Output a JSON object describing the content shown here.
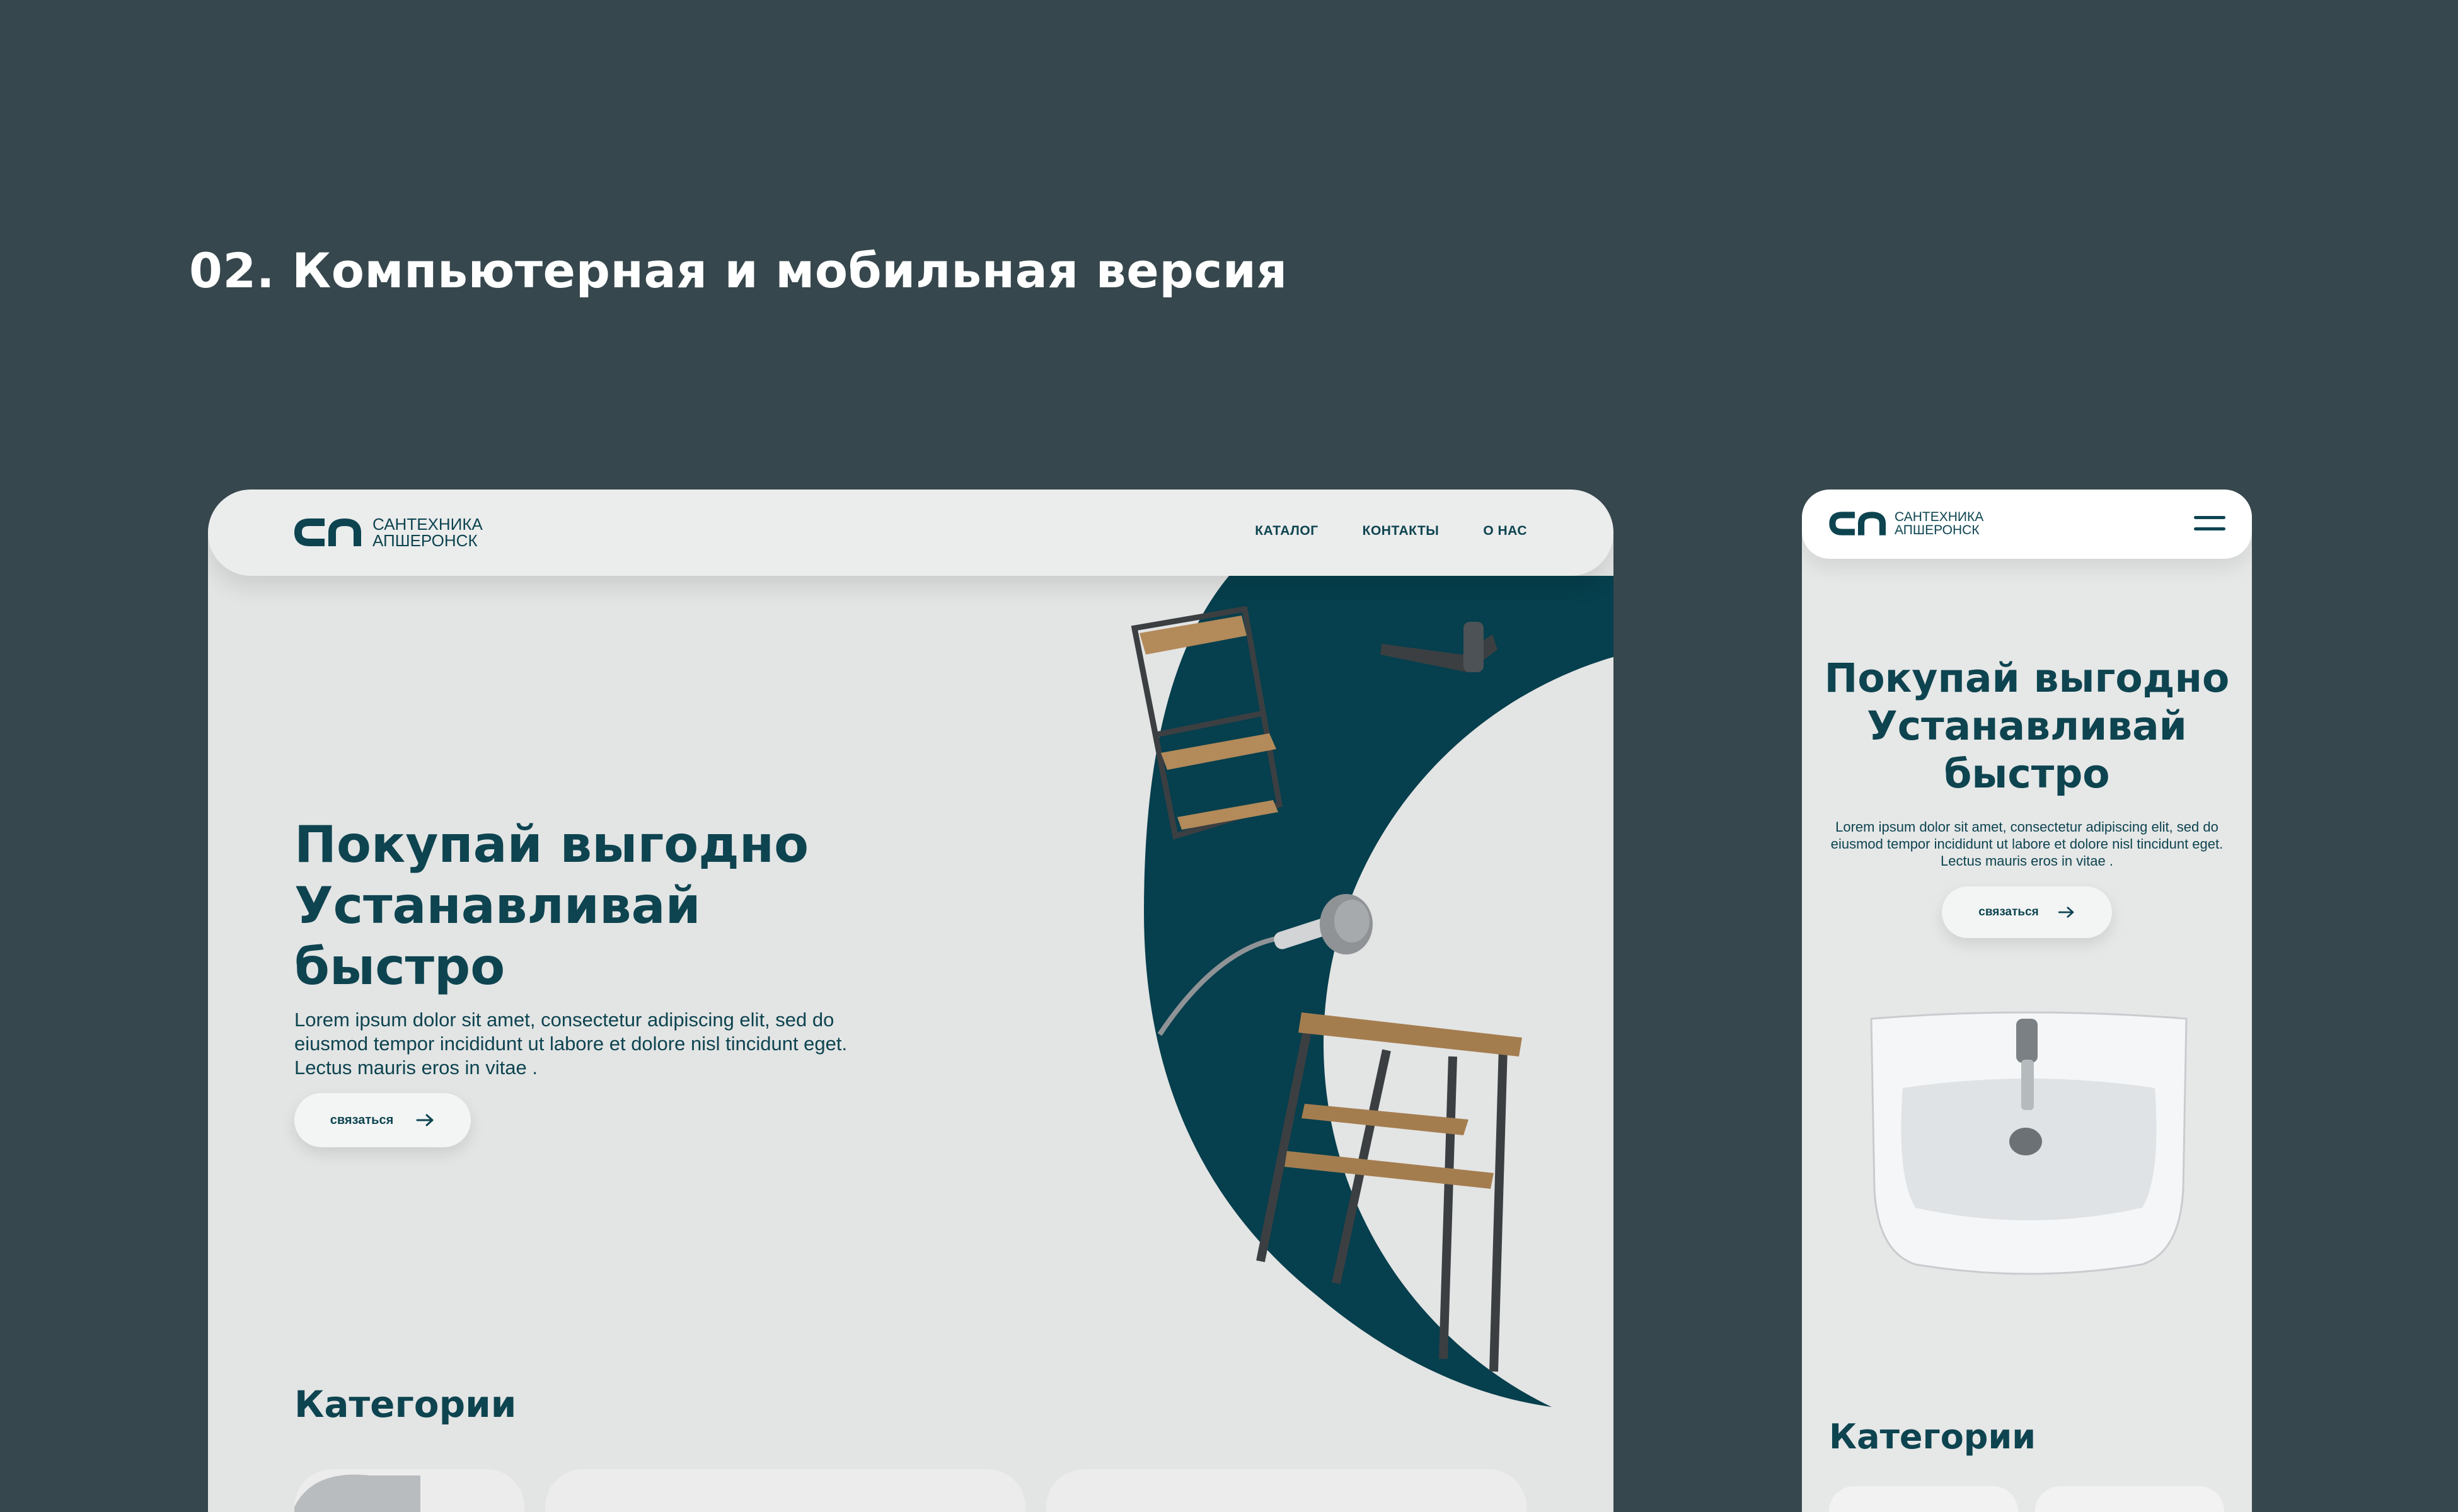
{
  "page": {
    "section_title": "02. Компьютерная и мобильная версия"
  },
  "brand": {
    "line1": "САНТЕХНИКА",
    "line2": "АПШЕРОНСК",
    "primary_color": "#0d4450",
    "background": "#36474d"
  },
  "desktop": {
    "nav": {
      "items": [
        "КАТАЛОГ",
        "КОНТАКТЫ",
        "О НАС"
      ]
    },
    "hero": {
      "title_lines": [
        "Покупай выгодно",
        "Устанавливай",
        "быстро"
      ],
      "description": "Lorem ipsum dolor sit amet, consectetur adipiscing elit, sed do eiusmod tempor incididunt ut labore et dolore nisl tincidunt eget. Lectus mauris eros in vitae .",
      "cta_label": "связаться"
    },
    "categories_title": "Категории"
  },
  "mobile": {
    "hero": {
      "title_lines": [
        "Покупай выгодно",
        "Устанавливай",
        "быстро"
      ],
      "description": "Lorem ipsum dolor sit amet, consectetur adipiscing elit, sed do eiusmod tempor incididunt ut labore et dolore nisl tincidunt eget. Lectus mauris eros in vitae .",
      "cta_label": "связаться"
    },
    "categories_title": "Категории"
  },
  "icons": [
    "logo-mark-icon",
    "arrow-right-icon",
    "hamburger-menu-icon"
  ]
}
